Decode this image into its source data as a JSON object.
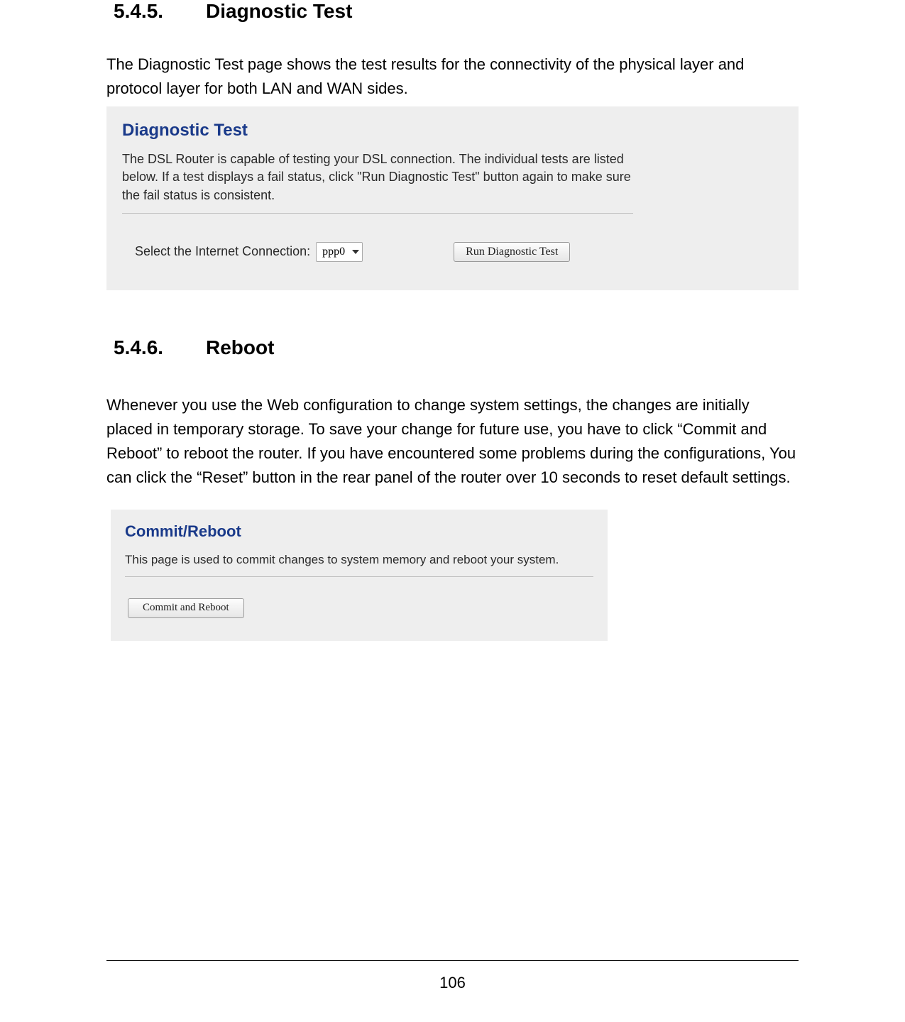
{
  "section1": {
    "num": "5.4.5.",
    "title": "Diagnostic Test",
    "body": "The Diagnostic Test page shows the test results for the connectivity of the physical layer and protocol layer for both LAN and WAN sides."
  },
  "panel1": {
    "title": "Diagnostic Test",
    "desc": "The DSL Router is capable of testing your DSL connection. The individual tests are listed below. If a test displays a fail status, click \"Run Diagnostic Test\" button again to make sure the fail status is consistent.",
    "select_label": "Select the Internet Connection:",
    "select_value": "ppp0",
    "run_button": "Run Diagnostic Test"
  },
  "section2": {
    "num": "5.4.6.",
    "title": "Reboot",
    "body": "Whenever you use the Web configuration to change system settings, the changes are initially placed in temporary storage. To save your change for future use, you have to click “Commit and Reboot” to reboot the router. If you have encountered some problems during the configurations, You can click the “Reset” button in the rear panel of the router over 10 seconds to reset default settings."
  },
  "panel2": {
    "title": "Commit/Reboot",
    "desc": "This page is used to commit changes to system memory and reboot your system.",
    "commit_button": "Commit and Reboot"
  },
  "page_number": "106"
}
